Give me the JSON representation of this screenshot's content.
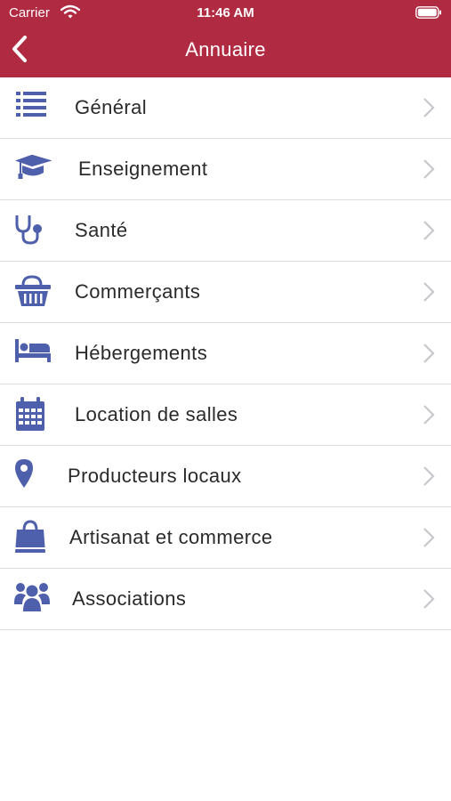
{
  "status_bar": {
    "carrier": "Carrier",
    "time": "11:46 AM"
  },
  "nav": {
    "title": "Annuaire"
  },
  "colors": {
    "header": "#b02a42",
    "icon": "#4e5fab"
  },
  "items": [
    {
      "label": "Général",
      "icon": "list-icon"
    },
    {
      "label": "Enseignement",
      "icon": "graduation-cap-icon"
    },
    {
      "label": "Santé",
      "icon": "stethoscope-icon"
    },
    {
      "label": "Commerçants",
      "icon": "basket-icon"
    },
    {
      "label": "Hébergements",
      "icon": "bed-icon"
    },
    {
      "label": "Location de salles",
      "icon": "calendar-icon"
    },
    {
      "label": "Producteurs locaux",
      "icon": "map-pin-icon"
    },
    {
      "label": "Artisanat et commerce",
      "icon": "shopping-bag-icon"
    },
    {
      "label": "Associations",
      "icon": "users-icon"
    }
  ]
}
